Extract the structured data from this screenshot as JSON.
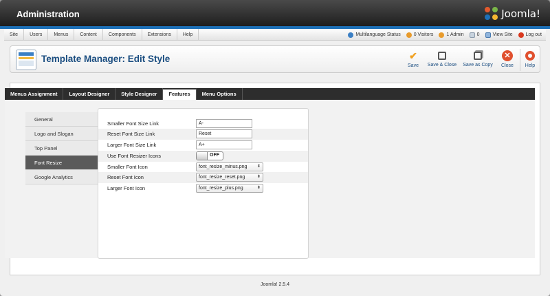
{
  "header": {
    "title": "Administration",
    "logo_text": "Joomla!"
  },
  "menubar": {
    "items": [
      "Site",
      "Users",
      "Menus",
      "Content",
      "Components",
      "Extensions",
      "Help"
    ],
    "status": {
      "multilanguage": "Multilanguage Status",
      "visitors": "0 Visitors",
      "admin": "1 Admin",
      "messages": "0",
      "view_site": "View Site",
      "logout": "Log out"
    }
  },
  "toolbar": {
    "page_title": "Template Manager: Edit Style",
    "buttons": {
      "save": "Save",
      "save_close": "Save & Close",
      "save_copy": "Save as Copy",
      "close": "Close",
      "help": "Help"
    }
  },
  "tabs": [
    "Menus Assignment",
    "Layout Designer",
    "Style Designer",
    "Features",
    "Menu Options"
  ],
  "active_tab": "Features",
  "subnav": [
    "General",
    "Logo and Slogan",
    "Top Panel",
    "Font Resize",
    "Google Analytics"
  ],
  "active_subnav": "Font Resize",
  "form": {
    "smaller_link": {
      "label": "Smaller Font Size Link",
      "value": "A-"
    },
    "reset_link": {
      "label": "Reset Font Size Link",
      "value": "Reset"
    },
    "larger_link": {
      "label": "Larger Font Size Link",
      "value": "A+"
    },
    "use_icons": {
      "label": "Use Font Resizer Icons",
      "state": "OFF"
    },
    "smaller_icon": {
      "label": "Smaller Font Icon",
      "value": "font_resize_minus.png"
    },
    "reset_icon": {
      "label": "Reset Font Icon",
      "value": "font_resize_reset.png"
    },
    "larger_icon": {
      "label": "Larger Font Icon",
      "value": "font_resize_plus.png"
    }
  },
  "footer": {
    "version": "Joomla! 2.5.4"
  },
  "colors": {
    "accent": "#1d70b7",
    "title": "#1a4d80",
    "save": "#f0a020",
    "close": "#e0502e"
  }
}
